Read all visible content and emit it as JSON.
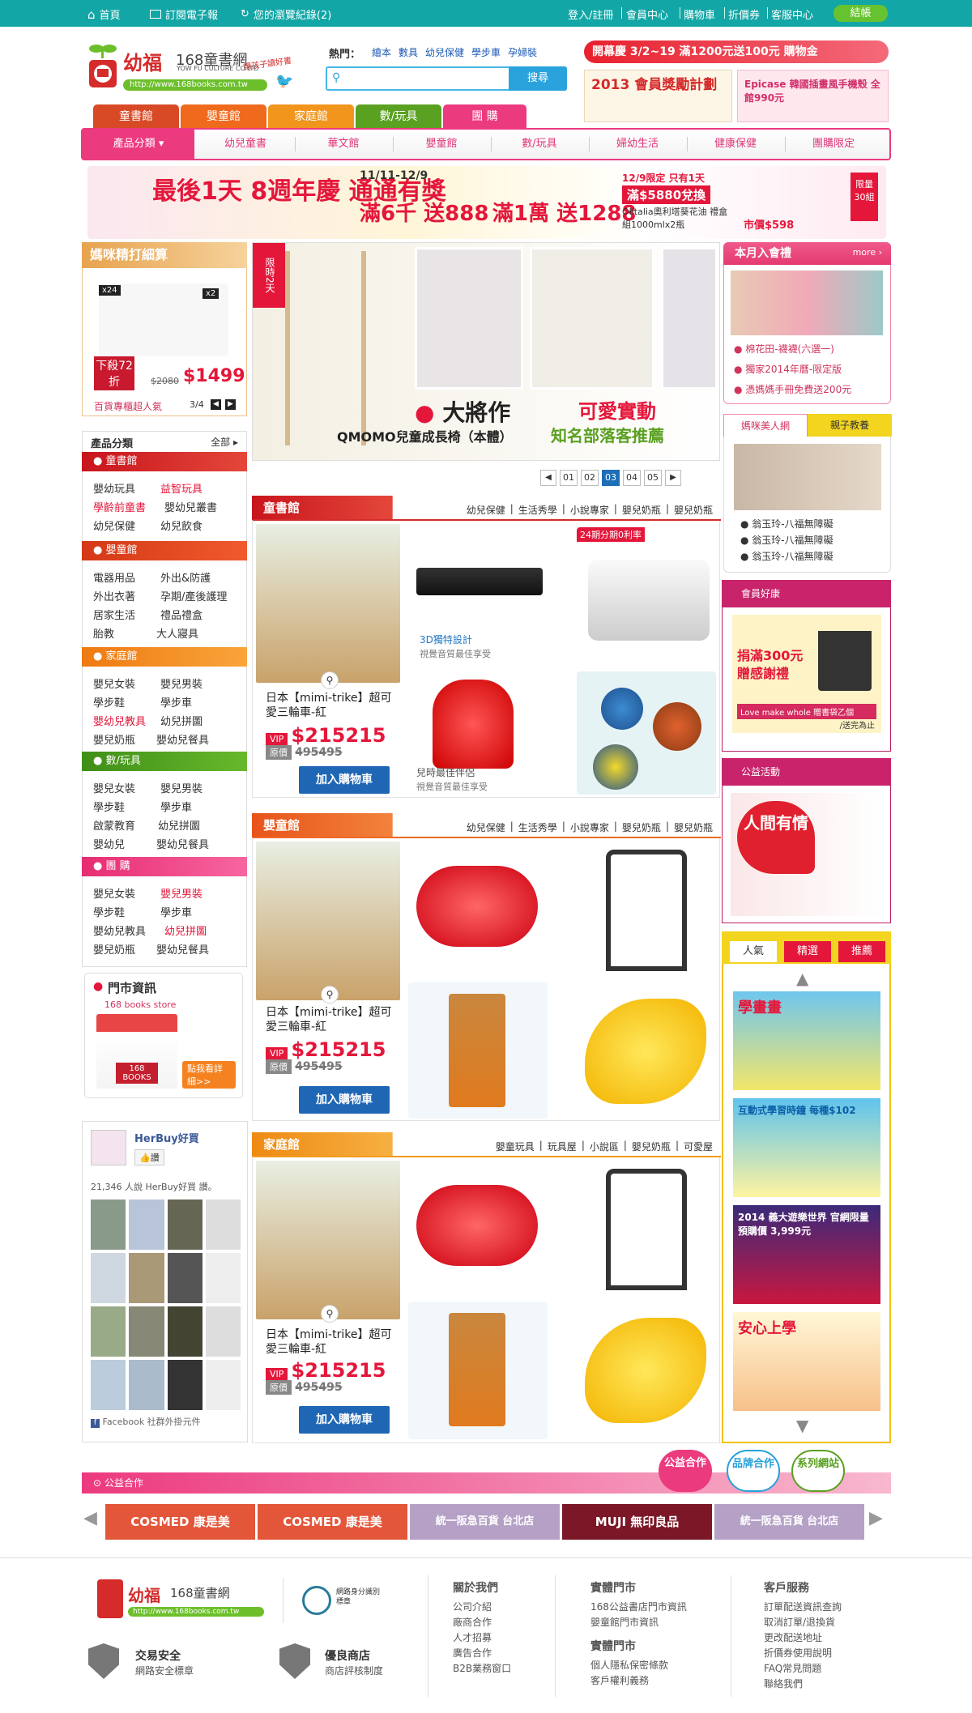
{
  "topbar": {
    "home": "首頁",
    "newsletter": "訂閱電子報",
    "history": "您的瀏覽紀錄(2)",
    "login": "登入/註冊",
    "member": "會員中心",
    "cart": "購物車",
    "coupon": "折價券",
    "service": "客服中心",
    "checkout": "結帳"
  },
  "brand": {
    "name": "幼福",
    "site": "168童書網",
    "tagline": "讓孩子讀好書",
    "company": "YOW FU CULTURE CO.LTD",
    "url": "http://www.168books.com.tw"
  },
  "search": {
    "hot_label": "熱門：",
    "hot_terms": [
      "繪本",
      "數具",
      "幼兒保健",
      "學步車",
      "孕婦裝"
    ],
    "placeholder": "",
    "button": "搜尋"
  },
  "promo_header": {
    "text": "開幕慶 3/2~19 滿1200元送100元 購物金",
    "plan": "2013 會員獎勵計劃",
    "epicase": "Epicase 韓國插畫風手機殼 全館990元"
  },
  "category_tabs": [
    "童書館",
    "嬰童館",
    "家庭館",
    "數/玩具",
    "團 購"
  ],
  "nav": {
    "menu": "產品分類",
    "items": [
      "幼兒童書",
      "華文館",
      "嬰童館",
      "數/玩具",
      "婦幼生活",
      "健康保健",
      "團購限定"
    ]
  },
  "banner": {
    "left": "最後1天 8週年慶 通通有獎",
    "dates": "11/11-12/9",
    "offer1": "滿6千 送888",
    "offer2": "滿1萬 送1288",
    "right_date": "12/9限定 只有1天",
    "right_offer": "滿$5880兌換",
    "right_product": "Olitalia奧利塔葵花油 禮盒組1000mlx2瓶",
    "right_price": "市價$598",
    "badge": "限量30組"
  },
  "mom_deal": {
    "title": "媽咪精打細算",
    "badge1": "x24",
    "badge2": "x2",
    "discount": "下殺72折",
    "old_price": "$2080",
    "new_price": "$1499",
    "caption": "百貨專櫃超人氣",
    "page": "3/4"
  },
  "sidebar": {
    "header": "產品分類",
    "all": "全部",
    "groups": [
      {
        "title": "童書館",
        "links": [
          "嬰幼玩具",
          "益智玩具",
          "學齡前童書",
          "嬰幼兒叢書",
          "幼兒保健",
          "幼兒飲食"
        ]
      },
      {
        "title": "嬰童館",
        "links": [
          "電器用品",
          "外出&防護",
          "外出衣著",
          "孕期/產後護理",
          "居家生活",
          "禮品禮盒",
          "胎教",
          "大人寢具"
        ]
      },
      {
        "title": "家庭館",
        "links": [
          "嬰兒女裝",
          "嬰兒男裝",
          "學步鞋",
          "學步車",
          "嬰幼兒教具",
          "幼兒拼圖",
          "嬰兒奶瓶",
          "嬰幼兒餐具"
        ]
      },
      {
        "title": "數/玩具",
        "links": [
          "嬰兒女裝",
          "嬰兒男裝",
          "學步鞋",
          "學步車",
          "啟蒙教育",
          "幼兒拼圖",
          "嬰幼兒",
          "嬰幼兒餐具"
        ]
      },
      {
        "title": "團 購",
        "links": [
          "嬰兒女裝",
          "嬰兒男裝",
          "學步鞋",
          "學步車",
          "嬰幼兒教具",
          "幼兒拼圖",
          "嬰兒奶瓶",
          "嬰幼兒餐具"
        ]
      }
    ]
  },
  "store": {
    "title": "門市資訊",
    "name": "168 books store",
    "cta": "點我看詳細>>",
    "sign": "168 BOOKS"
  },
  "facebook": {
    "page": "HerBuy好買",
    "like": "讚",
    "count": "21,346 人說 HerBuy好買 讚。",
    "footer": "Facebook 社群外掛元件"
  },
  "hero": {
    "badge": "限時2天",
    "brand": "大將作",
    "product": "QMOMO兒童成長椅（本體）",
    "headline": "可愛實動",
    "sub": "知名部落客推薦",
    "pages": [
      "01",
      "02",
      "03",
      "04",
      "05"
    ],
    "active_page": "03"
  },
  "sections": [
    {
      "title": "童書館",
      "links": [
        "幼兒保健",
        "生活秀學",
        "小說專家",
        "嬰兒奶瓶",
        "嬰兒奶瓶"
      ],
      "product": "日本【mimi-trike】超可愛三輪車-紅",
      "vip": "VIP",
      "price": "$215215",
      "orig_label": "原價",
      "orig_price": "495495",
      "cart": "加入購物車",
      "caption1": "3D獨特設計",
      "caption1b": "視覺音質最佳享受",
      "caption2": "兒時最佳伴侶",
      "caption2b": "視覺音質最佳享受",
      "camera": "24期分期0利率"
    },
    {
      "title": "嬰童館",
      "links": [
        "幼兒保健",
        "生活秀學",
        "小說專家",
        "嬰兒奶瓶",
        "嬰兒奶瓶"
      ],
      "product": "日本【mimi-trike】超可愛三輪車-紅",
      "vip": "VIP",
      "price": "$215215",
      "orig_label": "原價",
      "orig_price": "495495",
      "cart": "加入購物車"
    },
    {
      "title": "家庭館",
      "links": [
        "嬰童玩具",
        "玩具屋",
        "小說區",
        "嬰兒奶瓶",
        "可愛屋"
      ],
      "product": "日本【mimi-trike】超可愛三輪車-紅",
      "vip": "VIP",
      "price": "$215215",
      "orig_label": "原價",
      "orig_price": "495495",
      "cart": "加入購物車"
    }
  ],
  "right": {
    "gift_title": "本月入會禮",
    "more": "more",
    "gift_links": [
      "棉花田-襪襪(六選一)",
      "獨家2014年曆-限定版",
      "憑媽媽手冊免費送200元"
    ],
    "tabs": [
      "媽咪美人網",
      "親子教養"
    ],
    "news": [
      "翁玉玲-八福無障礙",
      "翁玉玲-八福無障礙",
      "翁玉玲-八福無障礙"
    ],
    "member_title": "會員好康",
    "member_offer": "捐滿300元 贈感謝禮",
    "member_bag": "Love make whole 贈書袋乙個",
    "member_note": "/送完為止",
    "charity_title": "公益活動",
    "charity_text": "人間有情",
    "rank_tabs": [
      "人氣",
      "精選",
      "推薦"
    ],
    "rank_items": [
      "學畫畫",
      "互動式學習時鐘 每種$102",
      "2014 義大遊樂世界 官網限量預購價 3,999元",
      "安心上學"
    ]
  },
  "partners": {
    "label": "公益合作",
    "bubbles": [
      "公益合作",
      "品牌合作",
      "系列網站"
    ],
    "logos": [
      "COSMED 康是美",
      "COSMED 康是美",
      "統一阪急百貨 台北店",
      "MUJI 無印良品",
      "統一阪急百貨 台北店"
    ]
  },
  "footer": {
    "badge1": "網路身分識別標章",
    "sec1_title": "交易安全",
    "sec1_sub": "網路安全標章",
    "sec2_title": "優良商店",
    "sec2_sub": "商店評核制度",
    "about_title": "關於我們",
    "about": [
      "公司介紹",
      "廠商合作",
      "人才招募",
      "廣告合作",
      "B2B業務窗口"
    ],
    "stores_title": "實體門市",
    "stores": [
      "168公益書店門市資訊",
      "嬰童館門市資訊"
    ],
    "stores2_title": "實體門市",
    "stores2": [
      "個人隱私保密條款",
      "客戶權利義務"
    ],
    "service_title": "客戶服務",
    "service": [
      "訂單配送資訊查詢",
      "取消訂單/退換貨",
      "更改配送地址",
      "折價券使用說明",
      "FAQ常見問題",
      "聯絡我們"
    ]
  },
  "colors": {
    "teal": "#13a6a6",
    "pink": "#ec3a7f",
    "red": "#e4173b",
    "blue": "#1f66b5",
    "orange": "#f28b1e",
    "green": "#5aa021"
  }
}
